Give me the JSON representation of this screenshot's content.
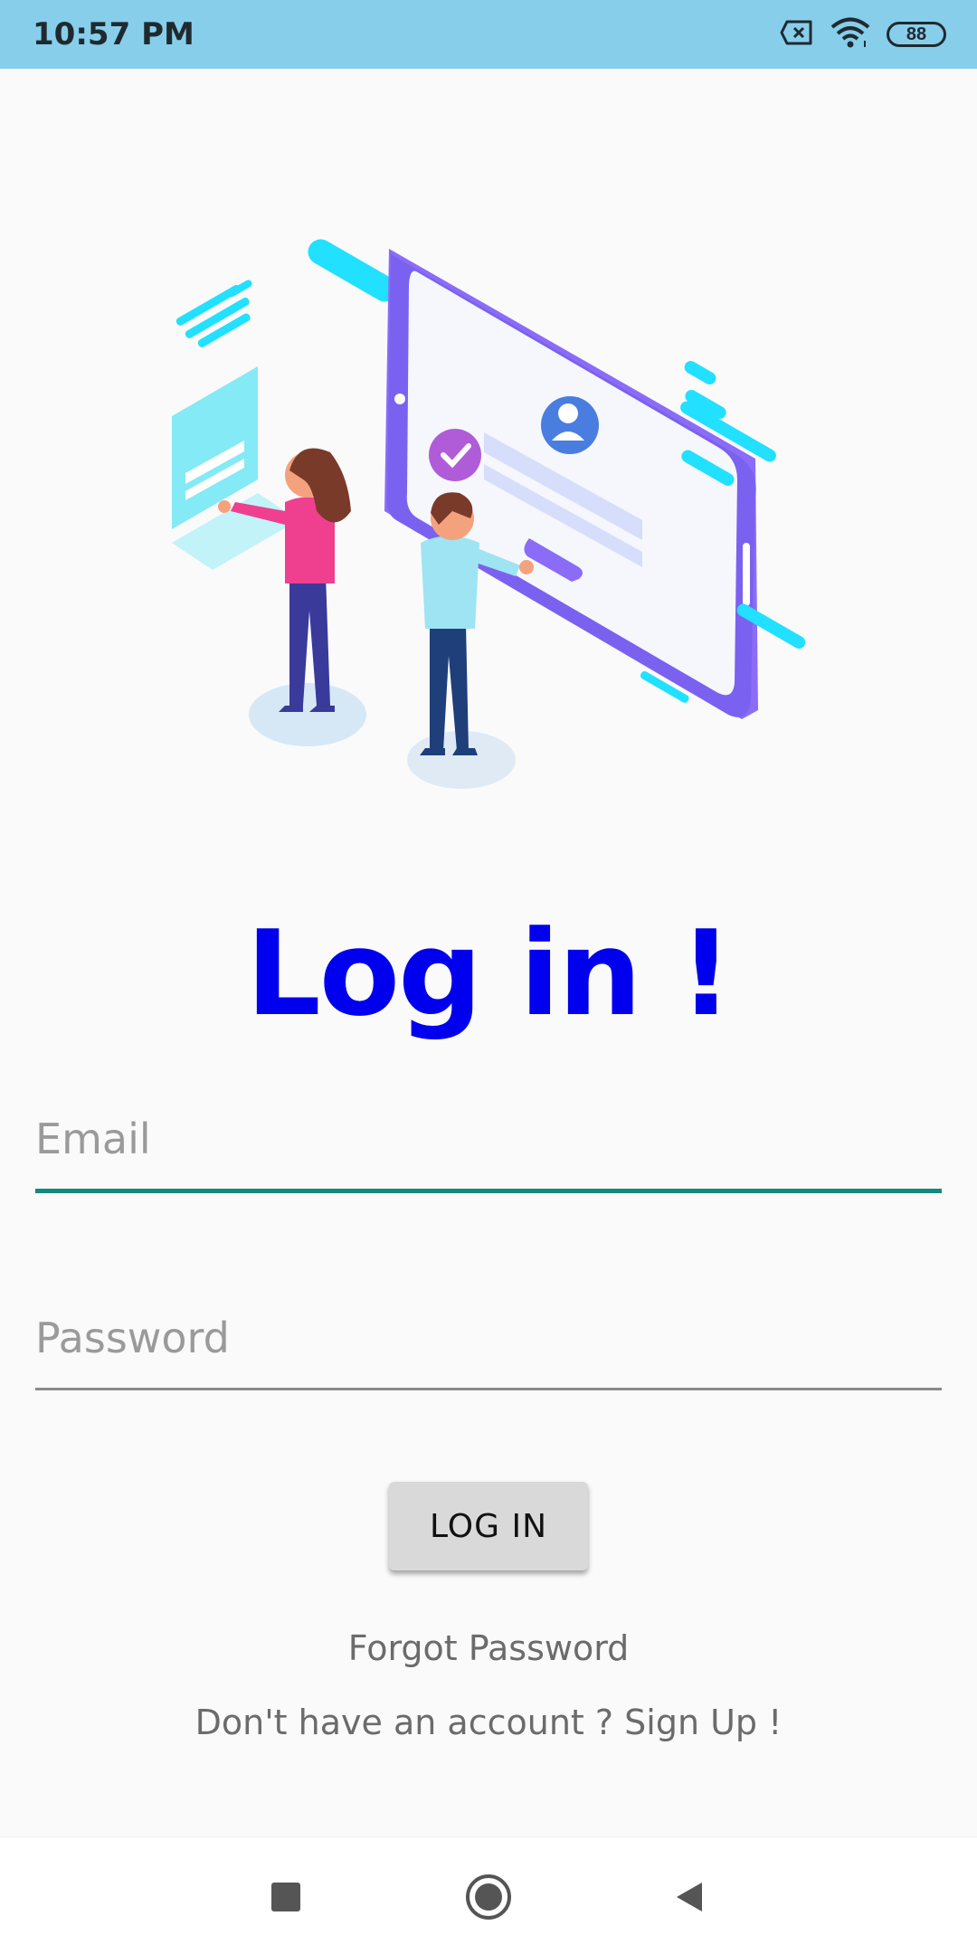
{
  "status_bar": {
    "time": "10:57 PM",
    "battery_level": "88",
    "icons": [
      "no-sim-icon",
      "wifi-icon",
      "battery-icon"
    ]
  },
  "login": {
    "title": "Log in !",
    "email_placeholder": "Email",
    "password_placeholder": "Password",
    "login_button": "LOG IN",
    "forgot_password": "Forgot Password",
    "signup_prompt": "Don't have an account ? Sign Up !"
  },
  "colors": {
    "status_bar": "#87ceeb",
    "title": "#0000ee",
    "email_underline_focused": "#138a7e",
    "button_bg": "#d9d9d9"
  },
  "nav_bar": {
    "icons": [
      "recents-square-icon",
      "home-circle-icon",
      "back-triangle-icon"
    ]
  }
}
